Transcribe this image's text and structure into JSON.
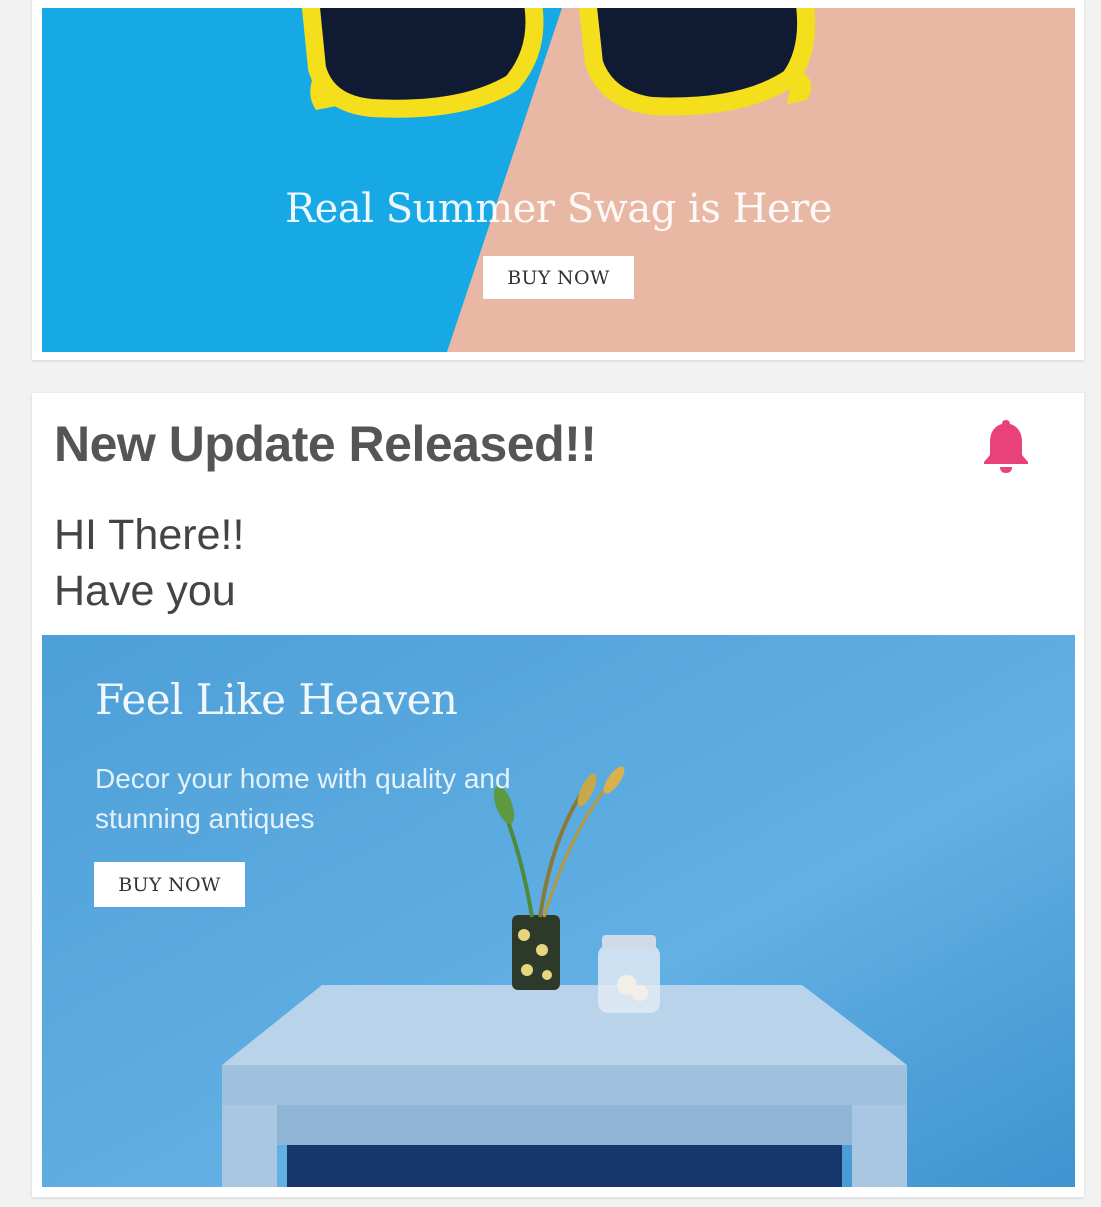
{
  "promo_banner": {
    "title": "Real Summer Swag is Here",
    "button_label": "BUY NOW"
  },
  "notification": {
    "title": "New Update Released!!",
    "body_lines": [
      "HI There!!",
      "Have you"
    ],
    "bell_color": "#e9427a"
  },
  "decor_banner": {
    "title": "Feel Like Heaven",
    "description": "Decor your home with quality and stunning antiques",
    "button_label": "BUY NOW"
  },
  "colors": {
    "page_background": "#f2f2f2",
    "banner1_blue": "#16a9e6",
    "banner1_peach": "#e8b8a4",
    "sunglasses_yellow": "#f5df1d",
    "banner2_blue": "#55a4dc",
    "accent_pink": "#e9427a"
  }
}
